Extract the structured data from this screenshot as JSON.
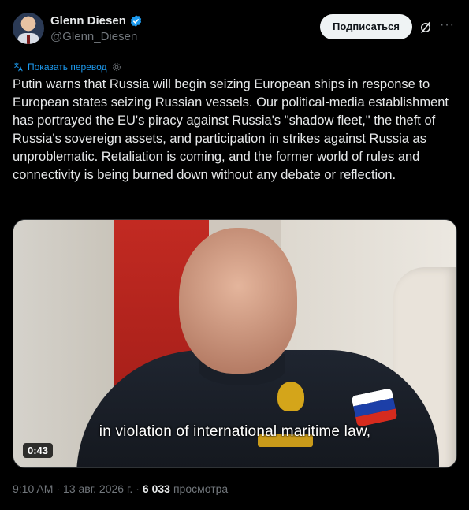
{
  "author": {
    "name": "Glenn Diesen",
    "handle": "@Glenn_Diesen",
    "verified": true
  },
  "actions": {
    "subscribe_label": "Подписаться",
    "grok_icon": "grok-slash-icon",
    "more_icon": "more-icon",
    "more_glyph": "···"
  },
  "translate": {
    "label": "Показать перевод",
    "icon": "translate-icon",
    "settings_icon": "gear-icon"
  },
  "tweet": {
    "text": "Putin warns that Russia will begin seizing European ships in response to European states seizing Russian vessels. Our political-media establishment has portrayed the EU's piracy against Russia's \"shadow fleet,\" the theft of Russia's sovereign assets, and participation in strikes against Russia as unproblematic. Retaliation is coming, and the former world of rules and connectivity is being burned down without any debate or reflection."
  },
  "media": {
    "caption": "in violation of international maritime law,",
    "duration": "0:43"
  },
  "meta": {
    "time": "9:10 AM",
    "separator1": "·",
    "date": "13 авг. 2026 г.",
    "separator2": "·",
    "views_count": "6 033",
    "views_label": "просмотра"
  },
  "colors": {
    "background": "#000000",
    "accent": "#1d9bf0",
    "muted": "#71767b",
    "text": "#e7e9ea"
  }
}
